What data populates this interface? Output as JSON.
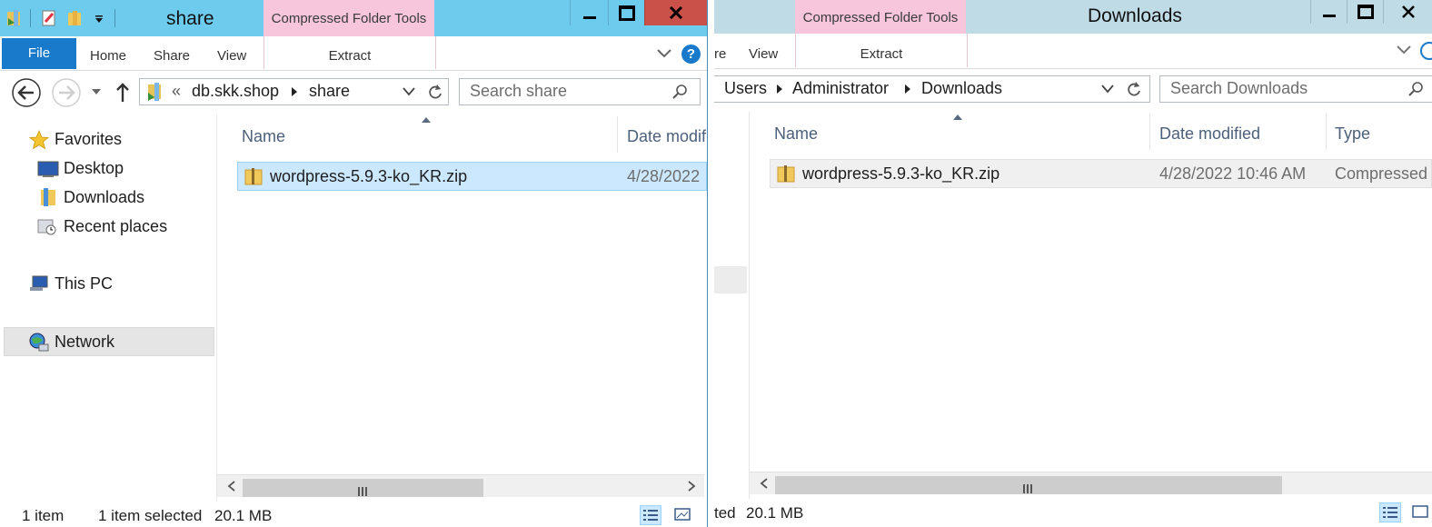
{
  "left_window": {
    "title": "share",
    "contextual_group": "Compressed Folder Tools",
    "ribbon_tabs": {
      "file": "File",
      "home": "Home",
      "share": "Share",
      "view": "View",
      "extract": "Extract"
    },
    "address": {
      "overflow": "«",
      "crumbs": [
        "db.skk.shop",
        "share"
      ]
    },
    "search_placeholder": "Search share",
    "nav": {
      "favorites": "Favorites",
      "desktop": "Desktop",
      "downloads": "Downloads",
      "recent": "Recent places",
      "this_pc": "This PC",
      "network": "Network"
    },
    "columns": {
      "name": "Name",
      "date": "Date modifi"
    },
    "files": [
      {
        "name": "wordpress-5.9.3-ko_KR.zip",
        "date": "4/28/2022"
      }
    ],
    "status": {
      "count": "1 item",
      "selected": "1 item selected",
      "size": "20.1 MB"
    }
  },
  "right_window": {
    "title": "Downloads",
    "contextual_group": "Compressed Folder Tools",
    "ribbon_tabs": {
      "share_partial": "re",
      "view": "View",
      "extract": "Extract"
    },
    "address": {
      "crumbs": [
        "Users",
        "Administrator",
        "Downloads"
      ]
    },
    "search_placeholder": "Search Downloads",
    "columns": {
      "name": "Name",
      "date": "Date modified",
      "type": "Type"
    },
    "files": [
      {
        "name": "wordpress-5.9.3-ko_KR.zip",
        "date": "4/28/2022 10:46 AM",
        "type": "Compressed"
      }
    ],
    "status": {
      "selected_partial": "ted",
      "size": "20.1 MB"
    }
  },
  "colors": {
    "active_titlebar": "#6dcbee",
    "inactive_titlebar": "#bfdbe6",
    "contextual_tab": "#f7c6dd",
    "file_tab": "#1979ca",
    "close_button": "#c9514a",
    "selection": "#cce8ff"
  }
}
